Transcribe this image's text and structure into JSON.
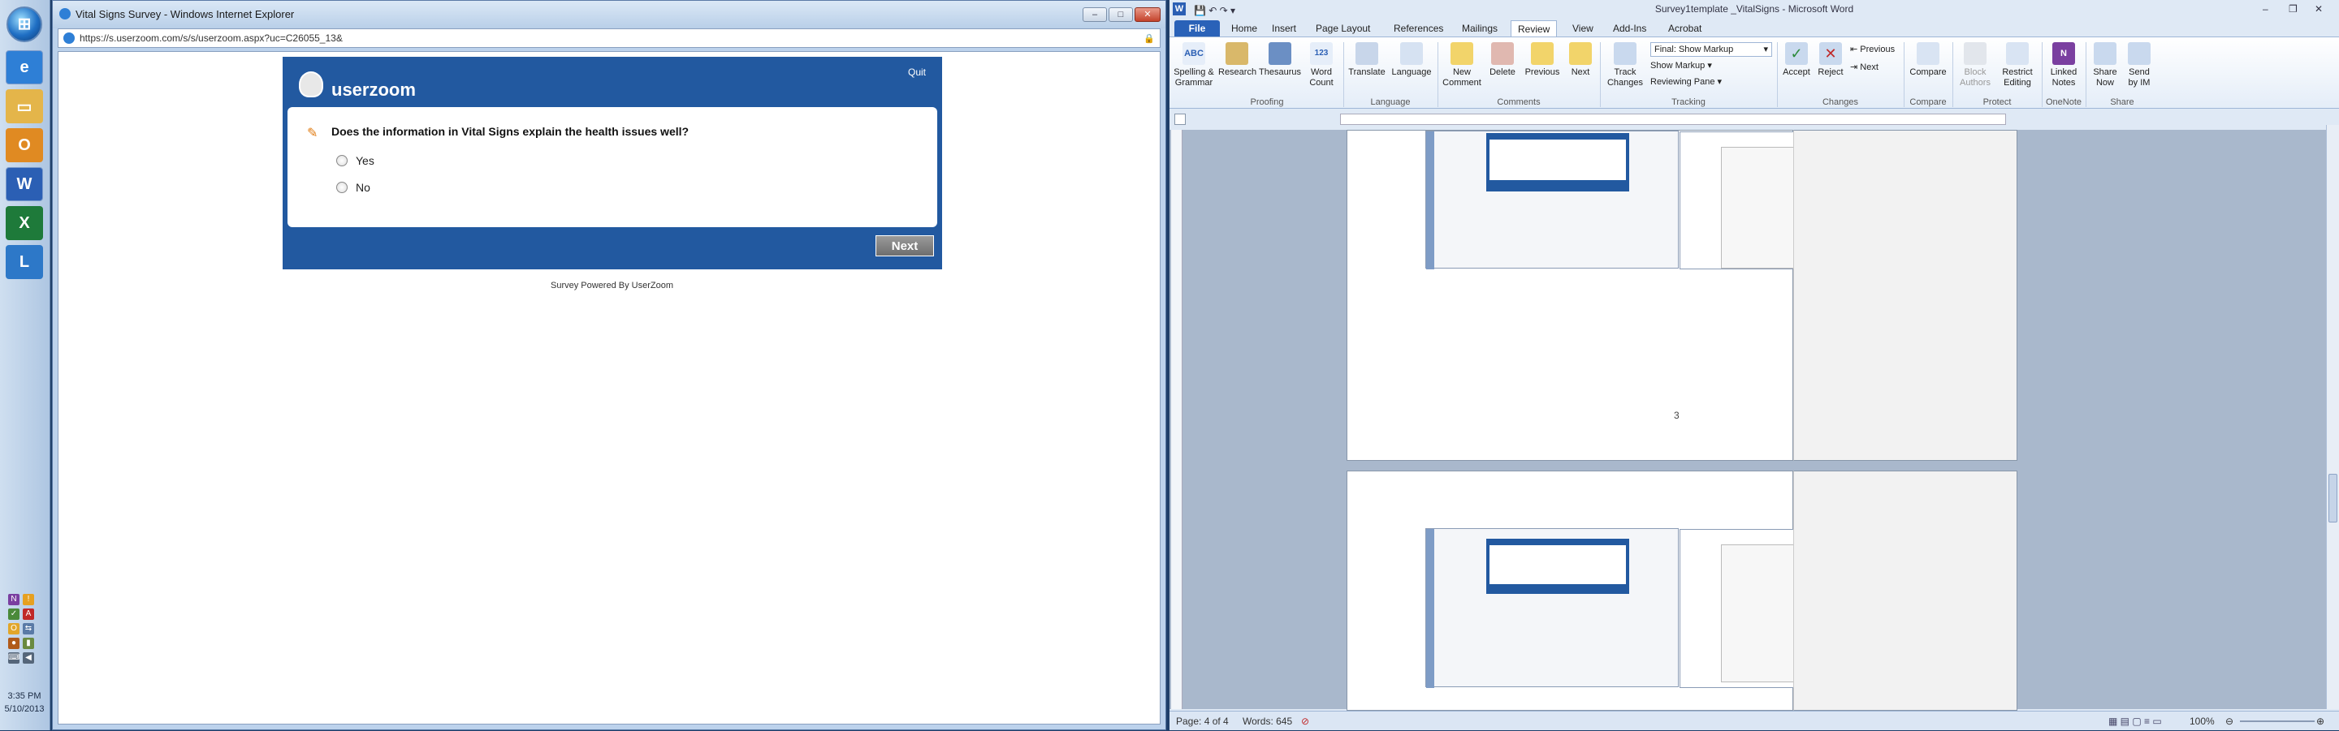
{
  "taskbar": {
    "clock_time": "3:35 PM",
    "clock_date": "5/10/2013",
    "apps": [
      "Internet Explorer",
      "Windows Explorer",
      "Outlook",
      "Word",
      "Excel",
      "Lync"
    ]
  },
  "ie": {
    "title": "Vital Signs Survey - Windows Internet Explorer",
    "url": "https://s.userzoom.com/s/s/userzoom.aspx?uc=C26055_13&",
    "survey": {
      "brand": "userzoom",
      "quit_label": "Quit",
      "question": "Does the information in Vital Signs explain the health issues well?",
      "options": [
        "Yes",
        "No"
      ],
      "next_label": "Next",
      "footer": "Survey Powered By UserZoom"
    }
  },
  "word": {
    "title": "Survey1template _VitalSigns - Microsoft Word",
    "tabs": [
      "File",
      "Home",
      "Insert",
      "Page Layout",
      "References",
      "Mailings",
      "Review",
      "View",
      "Add-Ins",
      "Acrobat"
    ],
    "active_tab": "Review",
    "ribbon": {
      "spelling": "Spelling & Grammar",
      "research": "Research",
      "thesaurus": "Thesaurus",
      "word_count": "Word Count",
      "proofing": "Proofing",
      "translate": "Translate",
      "language_btn": "Language",
      "language_grp": "Language",
      "new_comment": "New Comment",
      "delete": "Delete",
      "previous": "Previous",
      "next": "Next",
      "comments_grp": "Comments",
      "track_changes": "Track Changes",
      "final_markup": "Final: Show Markup",
      "show_markup": "Show Markup",
      "reviewing_pane": "Reviewing Pane",
      "tracking_grp": "Tracking",
      "accept": "Accept",
      "reject": "Reject",
      "prev_change": "Previous",
      "next_change": "Next",
      "changes_grp": "Changes",
      "compare": "Compare",
      "compare_grp": "Compare",
      "block_authors": "Block Authors",
      "restrict_editing": "Restrict Editing",
      "protect_grp": "Protect",
      "linked_notes": "Linked Notes",
      "onenote_grp": "OneNote",
      "share_now": "Share Now",
      "send_im": "Send by IM",
      "share_grp": "Share"
    },
    "page_number": "3",
    "status": {
      "page": "Page: 4 of 4",
      "words": "Words: 645",
      "zoom": "100%"
    }
  },
  "colors": {
    "survey_blue": "#2259a0",
    "word_file_tab": "#2a62b8"
  }
}
